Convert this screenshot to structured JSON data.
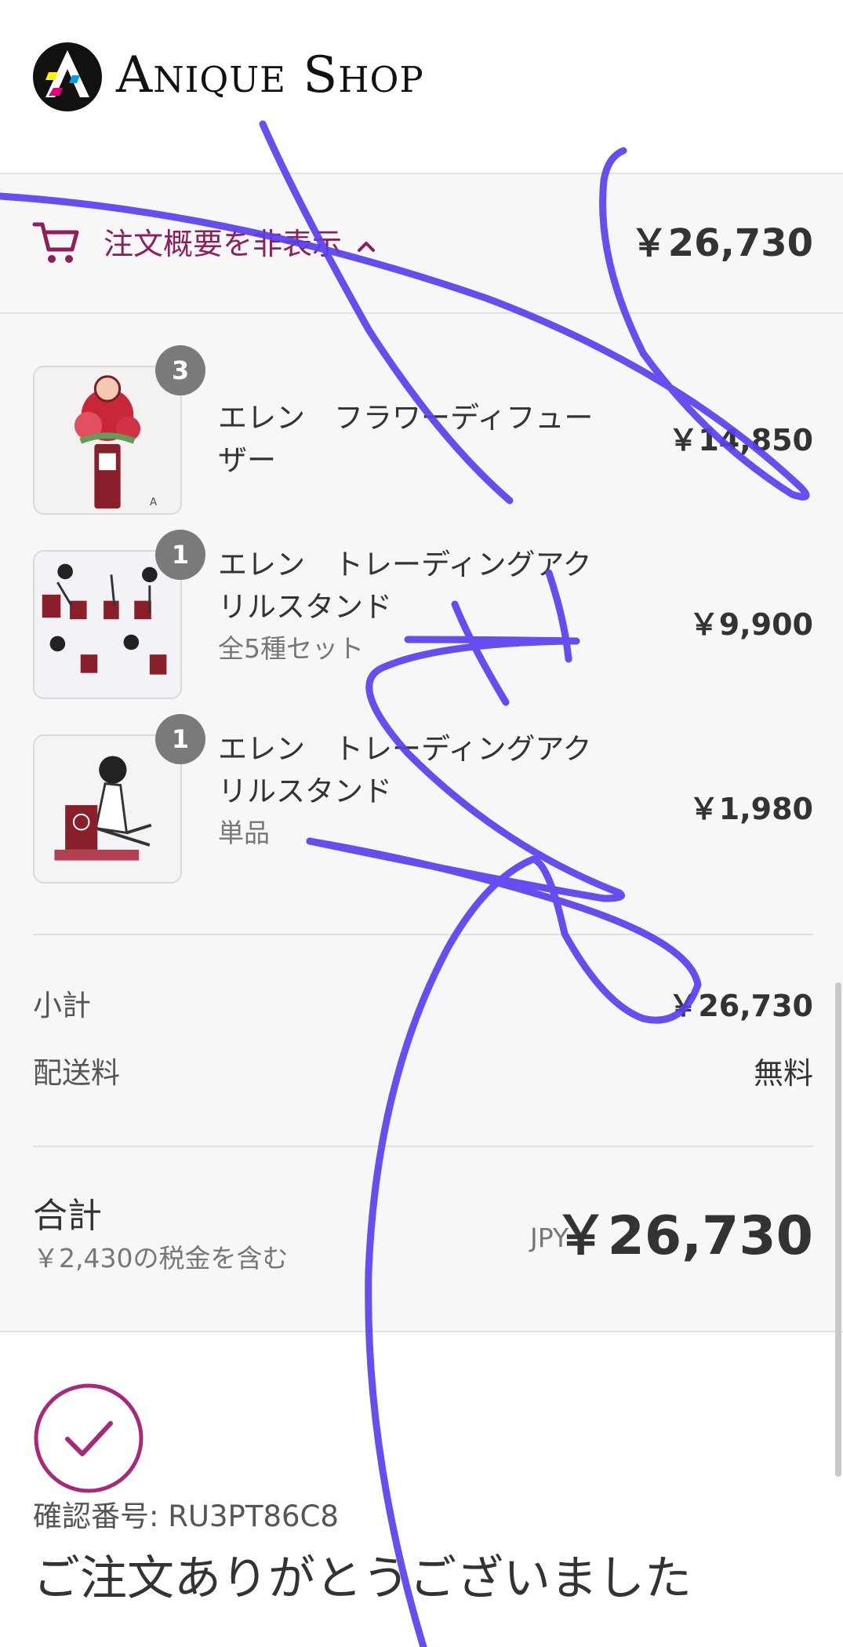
{
  "header": {
    "logo_text": "Anique Shop",
    "logo_icon": "anique-logo-icon"
  },
  "summary": {
    "toggle_label": "注文概要を非表示",
    "toggle_icon": "chevron-up-icon",
    "cart_icon": "cart-icon",
    "total": "￥26,730",
    "accent_color": "#8e1f5b"
  },
  "items": [
    {
      "quantity": "3",
      "title": "エレン　フラワーディフューザー",
      "variant": "",
      "price": "￥14,850"
    },
    {
      "quantity": "1",
      "title": "エレン　トレーディングアクリルスタンド",
      "variant": "全5種セット",
      "price": "￥9,900"
    },
    {
      "quantity": "1",
      "title": "エレン　トレーディングアクリルスタンド",
      "variant": "単品",
      "price": "￥1,980"
    }
  ],
  "costs": {
    "subtotal_label": "小計",
    "subtotal_value": "￥26,730",
    "shipping_label": "配送料",
    "shipping_value": "無料"
  },
  "total": {
    "label": "合計",
    "tax_note": "￥2,430の税金を含む",
    "currency": "JPY",
    "value": "￥26,730"
  },
  "confirmation": {
    "check_icon": "check-circle-icon",
    "number_text": "確認番号: RU3PT86C8",
    "thanks_text": "ご注文ありがとうございました"
  }
}
